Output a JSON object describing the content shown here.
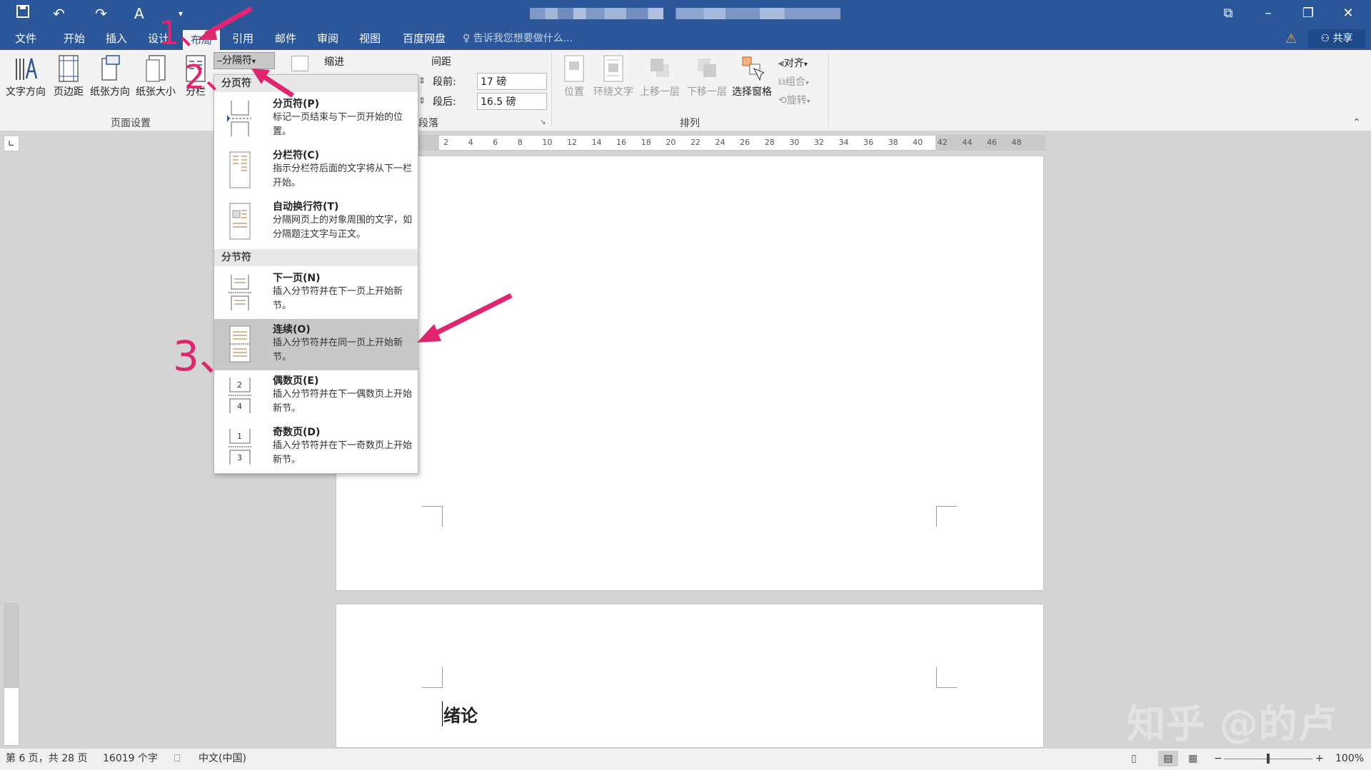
{
  "quick_access": {
    "save_icon": "save-icon",
    "undo_icon": "undo-icon",
    "redo_icon": "redo-icon",
    "format_icon": "format-painter-icon"
  },
  "tabs": [
    {
      "label": "文件"
    },
    {
      "label": "开始"
    },
    {
      "label": "插入"
    },
    {
      "label": "设计"
    },
    {
      "label": "布局"
    },
    {
      "label": "引用"
    },
    {
      "label": "邮件"
    },
    {
      "label": "审阅"
    },
    {
      "label": "视图"
    },
    {
      "label": "百度网盘"
    }
  ],
  "active_tab": "布局",
  "tell_me": "告诉我您想要做什么...",
  "share": "共享",
  "ribbon": {
    "page_setup": {
      "buttons": [
        "文字方向",
        "页边距",
        "纸张方向",
        "纸张大小",
        "分栏"
      ],
      "group_label": "页面设置"
    },
    "breaks_button": "分隔符",
    "indent_label": "缩进",
    "spacing_label": "间距",
    "before_label": "段前:",
    "before_value": "17 磅",
    "after_label": "段后:",
    "after_value": "16.5 磅",
    "paragraph_group": "段落",
    "arrange": {
      "buttons": [
        "位置",
        "环绕文字",
        "上移一层",
        "下移一层",
        "选择窗格"
      ],
      "align": "对齐",
      "group": "组合",
      "rotate": "旋转",
      "group_label": "排列"
    }
  },
  "ruler_ticks": [
    "2",
    "4",
    "6",
    "8",
    "10",
    "12",
    "14",
    "16",
    "18",
    "20",
    "22",
    "24",
    "26",
    "28",
    "30",
    "32",
    "34",
    "36",
    "38",
    "40",
    "42",
    "44",
    "46",
    "48"
  ],
  "dropdown": {
    "section_page": "分页符",
    "page_items": [
      {
        "title": "分页符(P)",
        "desc": "标记一页结束与下一页开始的位置。"
      },
      {
        "title": "分栏符(C)",
        "desc": "指示分栏符后面的文字将从下一栏开始。"
      },
      {
        "title": "自动换行符(T)",
        "desc": "分隔网页上的对象周围的文字，如分隔题注文字与正文。"
      }
    ],
    "section_section": "分节符",
    "section_items": [
      {
        "title": "下一页(N)",
        "desc": "插入分节符并在下一页上开始新节。"
      },
      {
        "title": "连续(O)",
        "desc": "插入分节符并在同一页上开始新节。"
      },
      {
        "title": "偶数页(E)",
        "desc": "插入分节符并在下一偶数页上开始新节。"
      },
      {
        "title": "奇数页(D)",
        "desc": "插入分节符并在下一奇数页上开始新节。"
      }
    ]
  },
  "annotations": {
    "step1": "1、",
    "step2": "2、",
    "step3": "3、"
  },
  "document": {
    "heading": "绪论"
  },
  "statusbar": {
    "page": "第 6 页，共 28 页",
    "words": "16019 个字",
    "language": "中文(中国)",
    "zoom": "100%"
  },
  "watermark": "知乎 @的卢",
  "colors": {
    "brand": "#2b579a",
    "annotation": "#e0246f"
  }
}
